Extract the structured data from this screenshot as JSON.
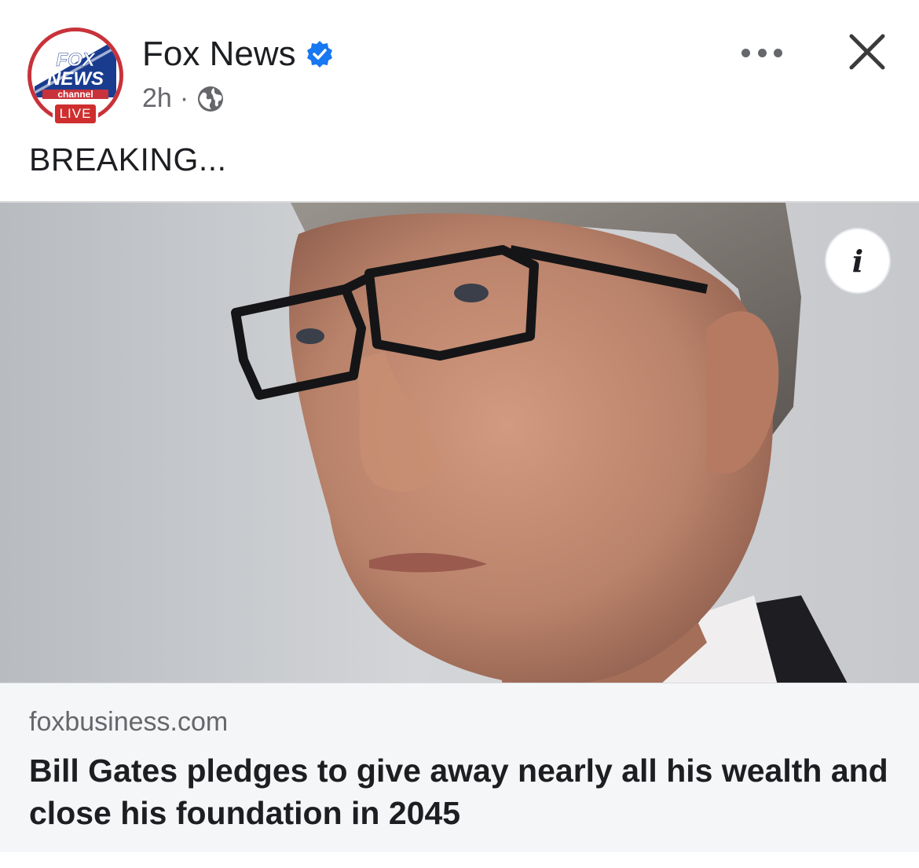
{
  "header": {
    "page_name": "Fox News",
    "timestamp": "2h",
    "separator": "·",
    "verified_icon": "verified-badge-icon",
    "privacy_icon": "globe-icon"
  },
  "avatar": {
    "logo_line1": "FOX",
    "logo_line2": "NEWS",
    "logo_line3": "channel",
    "live_badge": "LIVE"
  },
  "post": {
    "text": "BREAKING..."
  },
  "link_preview": {
    "domain": "foxbusiness.com",
    "title": "Bill Gates pledges to give away nearly all his wealth and close his foundation in 2045"
  },
  "controls": {
    "more_icon": "more-dots-icon",
    "close_icon": "close-icon",
    "info_label": "i"
  },
  "colors": {
    "brand_red": "#c8323a",
    "brand_blue": "#1a3c8f",
    "verified_blue": "#1877f2",
    "text_primary": "#1c1e21",
    "text_secondary": "#65676b"
  }
}
